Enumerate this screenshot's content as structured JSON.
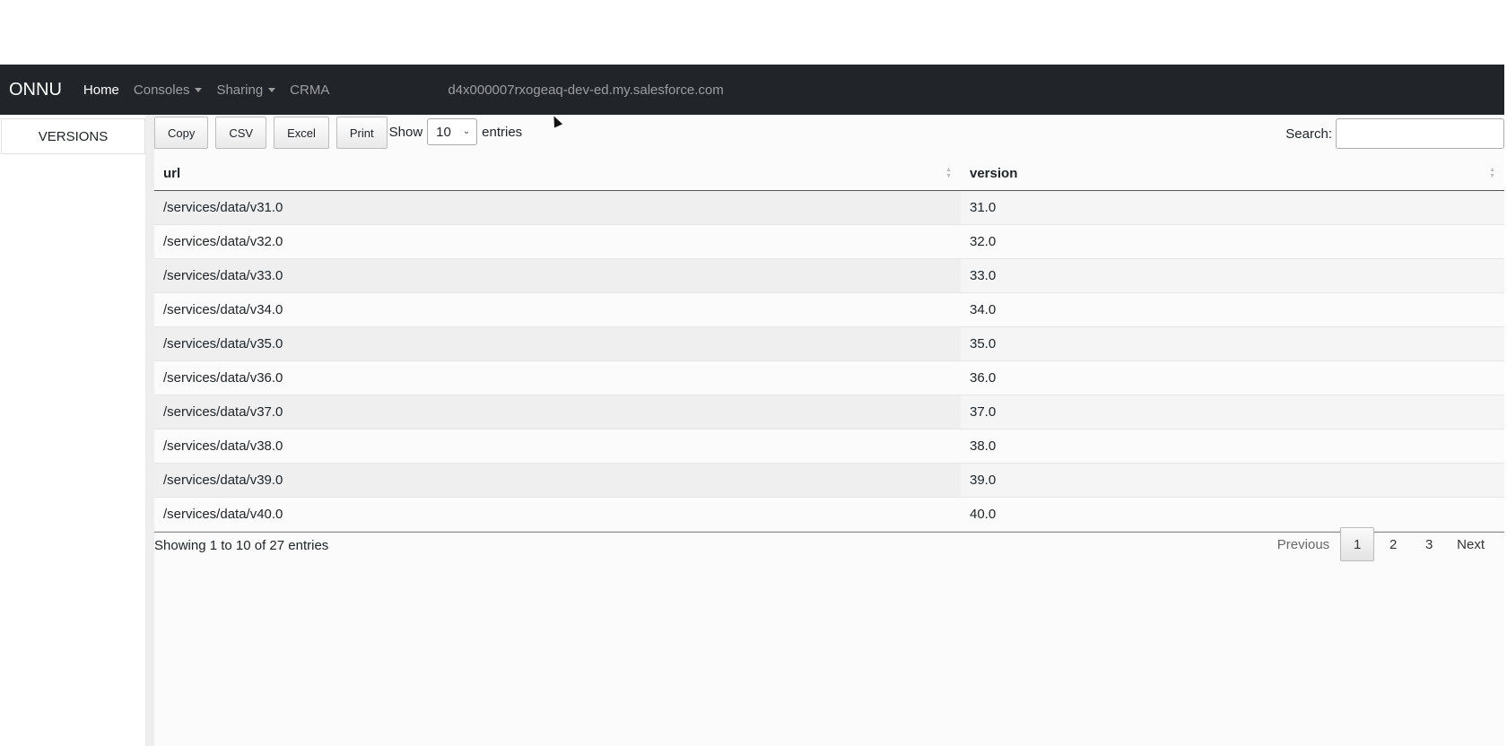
{
  "navbar": {
    "brand": "ONNU",
    "links": [
      {
        "label": "Home",
        "active": true,
        "dropdown": false
      },
      {
        "label": "Consoles",
        "active": false,
        "dropdown": true
      },
      {
        "label": "Sharing",
        "active": false,
        "dropdown": true
      },
      {
        "label": "CRMA",
        "active": false,
        "dropdown": false
      }
    ],
    "org_host": "d4x000007rxogeaq-dev-ed.my.salesforce.com"
  },
  "sidebar": {
    "items": [
      {
        "label": "VERSIONS"
      }
    ]
  },
  "toolbar": {
    "buttons": [
      "Copy",
      "CSV",
      "Excel",
      "Print"
    ],
    "show_label": "Show",
    "page_length": "10",
    "entries_label": "entries",
    "search_label": "Search:",
    "search_value": ""
  },
  "table": {
    "columns": [
      "url",
      "version"
    ],
    "rows": [
      {
        "url": "/services/data/v31.0",
        "version": "31.0"
      },
      {
        "url": "/services/data/v32.0",
        "version": "32.0"
      },
      {
        "url": "/services/data/v33.0",
        "version": "33.0"
      },
      {
        "url": "/services/data/v34.0",
        "version": "34.0"
      },
      {
        "url": "/services/data/v35.0",
        "version": "35.0"
      },
      {
        "url": "/services/data/v36.0",
        "version": "36.0"
      },
      {
        "url": "/services/data/v37.0",
        "version": "37.0"
      },
      {
        "url": "/services/data/v38.0",
        "version": "38.0"
      },
      {
        "url": "/services/data/v39.0",
        "version": "39.0"
      },
      {
        "url": "/services/data/v40.0",
        "version": "40.0"
      }
    ]
  },
  "footer": {
    "info": "Showing 1 to 10 of 27 entries",
    "pager": {
      "previous": "Previous",
      "pages": [
        "1",
        "2",
        "3"
      ],
      "current": "1",
      "next": "Next"
    }
  },
  "colors": {
    "navbar_bg": "#212529",
    "row_odd": "#efefef"
  }
}
